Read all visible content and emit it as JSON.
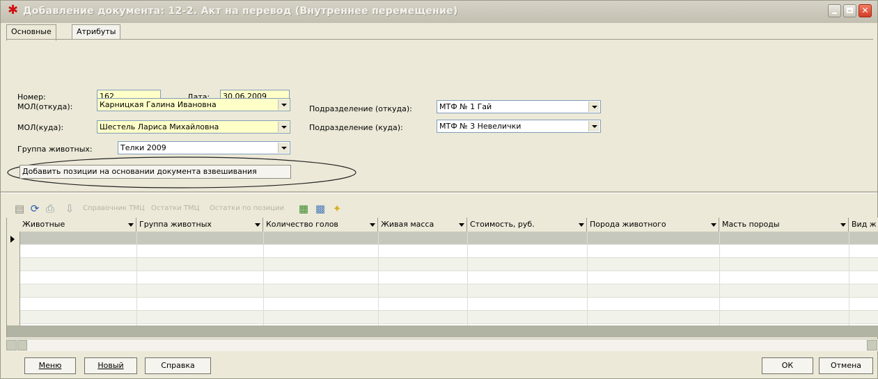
{
  "window": {
    "title": "Добавление документа: 12-2. Акт на перевод (Внутреннее перемещение)"
  },
  "tabs": [
    {
      "label": "Основные"
    },
    {
      "label": "Атрибуты"
    }
  ],
  "form": {
    "number_label": "Номер:",
    "number_value": "162",
    "date_label": "Дата:",
    "date_value": "30.06.2009",
    "mol_from_label": "МОЛ(откуда):",
    "mol_from_value": "Карницкая Галина Ивановна",
    "mol_to_label": "МОЛ(куда):",
    "mol_to_value": "Шестель Лариса Михайловна",
    "group_label": "Группа животных:",
    "group_value": "Телки 2009",
    "dept_from_label": "Подразделение (откуда):",
    "dept_from_value": "МТФ № 1 Гай",
    "dept_to_label": "Подразделение (куда):",
    "dept_to_value": "МТФ № 3 Невелички",
    "add_button_label": "Добавить позиции на основании документа взвешивания"
  },
  "toolbar": {
    "links": [
      "Справочник ТМЦ",
      "Остатки ТМЦ",
      "Остатки по позиции"
    ]
  },
  "grid": {
    "columns": [
      "Животные",
      "Группа животных",
      "Количество голов",
      "Живая масса",
      "Стоимость, руб.",
      "Порода животного",
      "Масть породы",
      "Вид ж"
    ]
  },
  "buttons": {
    "menu": "Меню",
    "new": "Новый",
    "help": "Справка",
    "ok": "ОК",
    "cancel": "Отмена"
  },
  "colors": {
    "required_field": "#ffffc8",
    "close_button": "#d33c24",
    "grid_footer": "#b1b4a3"
  }
}
